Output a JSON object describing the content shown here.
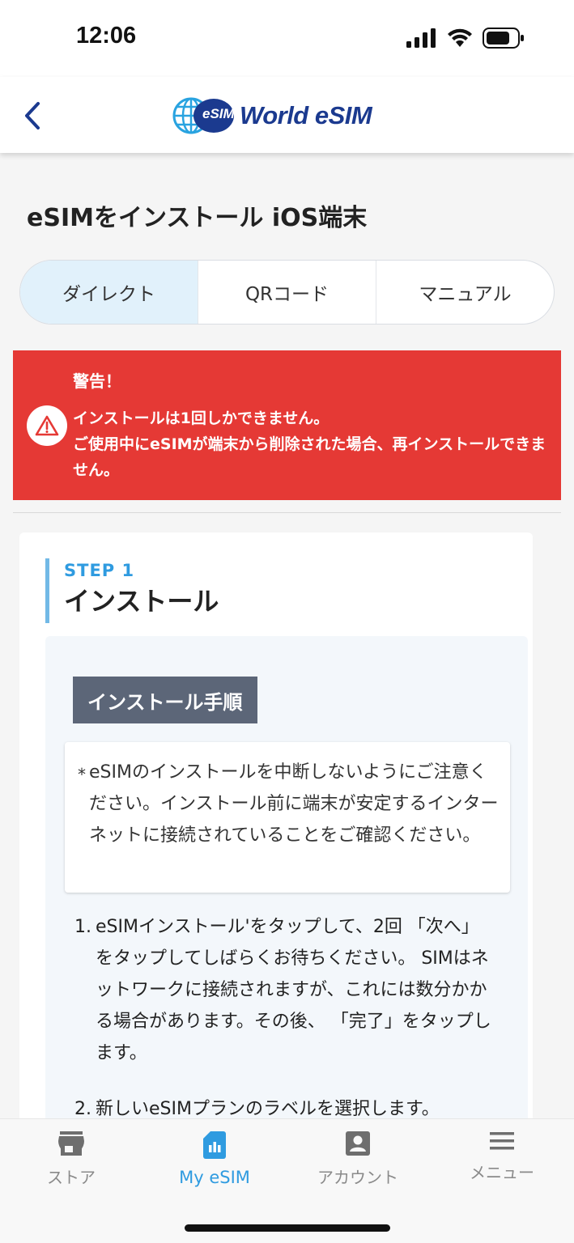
{
  "status_bar": {
    "time": "12:06",
    "icons": [
      "cellular-signal-icon",
      "wifi-icon",
      "battery-icon"
    ]
  },
  "header": {
    "back_icon": "chevron-left-icon",
    "logo_badge": "eSIM",
    "logo_text": "World eSIM"
  },
  "page": {
    "title": "eSIMをインストール iOS端末"
  },
  "tabs": [
    {
      "label": "ダイレクト",
      "active": true
    },
    {
      "label": "QRコード",
      "active": false
    },
    {
      "label": "マニュアル",
      "active": false
    }
  ],
  "warning": {
    "title": "警告！",
    "line1": "インストールは1回しかできません。",
    "line2": "ご使用中にeSIMが端末から削除された場合、再インストールできません。",
    "icon": "warning-triangle-icon",
    "color": "#e53935"
  },
  "step": {
    "label": "STEP 1",
    "title": "インストール",
    "procedure_badge": "インストール手順",
    "note_star": "*",
    "note": "eSIMのインストールを中断しないようにご注意ください。インストール前に端末が安定するインターネットに接続されていることをご確認ください。",
    "items": [
      {
        "num": "1.",
        "text": "eSIMインストール'をタップして、2回 「次へ」をタップしてしばらくお待ちください。 SIMはネットワークに接続されますが、これには数分かかる場合があります。その後、 「完了」をタップします。"
      },
      {
        "num": "2.",
        "text": "新しいeSIMプランのラベルを選択します。"
      }
    ]
  },
  "bottom_nav": [
    {
      "label": "ストア",
      "icon": "store-icon",
      "active": false
    },
    {
      "label": "My eSIM",
      "icon": "sim-card-icon",
      "active": true
    },
    {
      "label": "アカウント",
      "icon": "account-icon",
      "active": false
    },
    {
      "label": "メニュー",
      "icon": "menu-icon",
      "active": false
    }
  ],
  "colors": {
    "accent": "#2f9be0",
    "warning": "#e53935",
    "brand": "#1b3a8f"
  }
}
